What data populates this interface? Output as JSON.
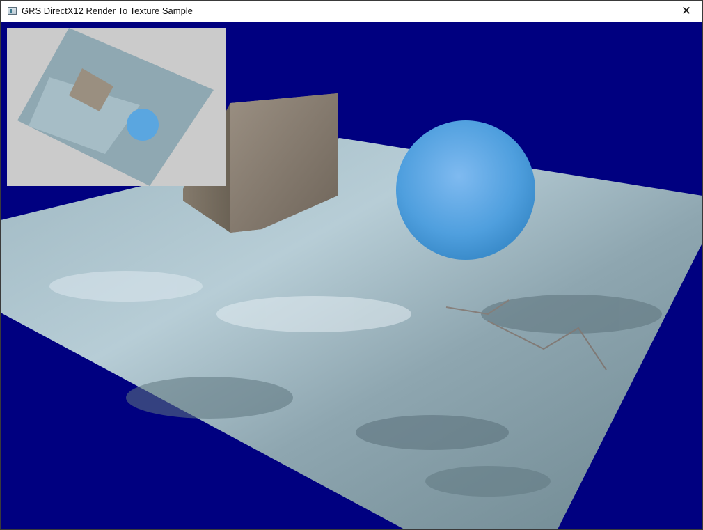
{
  "window": {
    "title": "GRS DirectX12 Render To Texture Sample",
    "app_icon": "app-window-icon",
    "close_glyph": "✕"
  },
  "scene": {
    "clear_color": "#000080",
    "floor_color": "#8fa9b4",
    "cube_color": "#8a7e70",
    "sphere_color": "#5aa6e0",
    "preview_background": "#cbcbcb"
  }
}
